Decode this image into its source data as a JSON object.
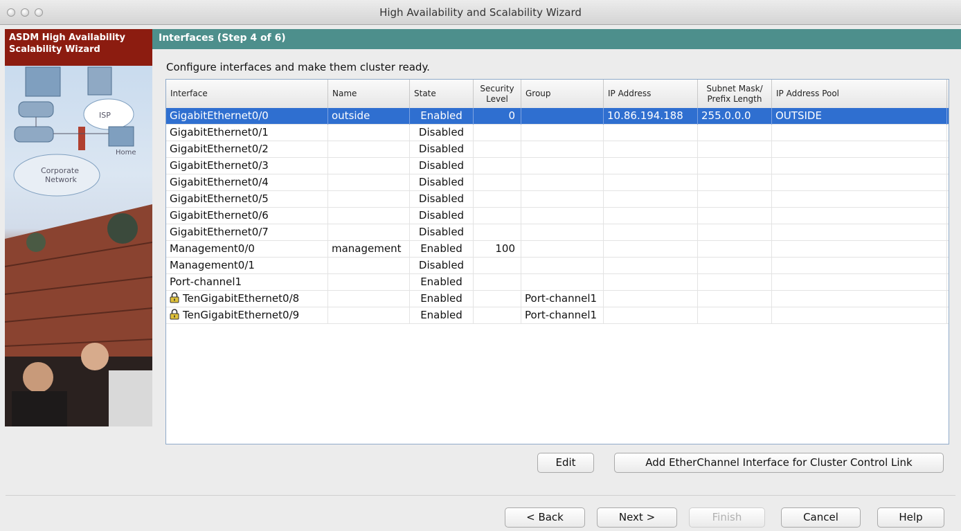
{
  "window": {
    "title": "High Availability and Scalability Wizard"
  },
  "sidebar": {
    "title_line1": "ASDM High Availability",
    "title_line2": "Scalability Wizard",
    "art_labels": {
      "isp": "ISP",
      "home": "Home",
      "corporate": "Corporate",
      "network": "Network"
    }
  },
  "header": {
    "step_title": "Interfaces (Step 4 of 6)"
  },
  "instruction": "Configure interfaces and make them cluster ready.",
  "table": {
    "columns": {
      "interface": "Interface",
      "name": "Name",
      "state": "State",
      "security_line1": "Security",
      "security_line2": "Level",
      "group": "Group",
      "ip": "IP Address",
      "mask_line1": "Subnet Mask/",
      "mask_line2": "Prefix Length",
      "pool": "IP Address Pool"
    },
    "rows": [
      {
        "interface": "GigabitEthernet0/0",
        "name": "outside",
        "state": "Enabled",
        "security": "0",
        "group": "",
        "ip": "10.86.194.188",
        "mask": "255.0.0.0",
        "pool": "OUTSIDE",
        "locked": false,
        "selected": true
      },
      {
        "interface": "GigabitEthernet0/1",
        "name": "",
        "state": "Disabled",
        "security": "",
        "group": "",
        "ip": "",
        "mask": "",
        "pool": "",
        "locked": false,
        "selected": false
      },
      {
        "interface": "GigabitEthernet0/2",
        "name": "",
        "state": "Disabled",
        "security": "",
        "group": "",
        "ip": "",
        "mask": "",
        "pool": "",
        "locked": false,
        "selected": false
      },
      {
        "interface": "GigabitEthernet0/3",
        "name": "",
        "state": "Disabled",
        "security": "",
        "group": "",
        "ip": "",
        "mask": "",
        "pool": "",
        "locked": false,
        "selected": false
      },
      {
        "interface": "GigabitEthernet0/4",
        "name": "",
        "state": "Disabled",
        "security": "",
        "group": "",
        "ip": "",
        "mask": "",
        "pool": "",
        "locked": false,
        "selected": false
      },
      {
        "interface": "GigabitEthernet0/5",
        "name": "",
        "state": "Disabled",
        "security": "",
        "group": "",
        "ip": "",
        "mask": "",
        "pool": "",
        "locked": false,
        "selected": false
      },
      {
        "interface": "GigabitEthernet0/6",
        "name": "",
        "state": "Disabled",
        "security": "",
        "group": "",
        "ip": "",
        "mask": "",
        "pool": "",
        "locked": false,
        "selected": false
      },
      {
        "interface": "GigabitEthernet0/7",
        "name": "",
        "state": "Disabled",
        "security": "",
        "group": "",
        "ip": "",
        "mask": "",
        "pool": "",
        "locked": false,
        "selected": false
      },
      {
        "interface": "Management0/0",
        "name": "management",
        "state": "Enabled",
        "security": "100",
        "group": "",
        "ip": "",
        "mask": "",
        "pool": "",
        "locked": false,
        "selected": false
      },
      {
        "interface": "Management0/1",
        "name": "",
        "state": "Disabled",
        "security": "",
        "group": "",
        "ip": "",
        "mask": "",
        "pool": "",
        "locked": false,
        "selected": false
      },
      {
        "interface": "Port-channel1",
        "name": "",
        "state": "Enabled",
        "security": "",
        "group": "",
        "ip": "",
        "mask": "",
        "pool": "",
        "locked": false,
        "selected": false
      },
      {
        "interface": "TenGigabitEthernet0/8",
        "name": "",
        "state": "Enabled",
        "security": "",
        "group": "Port-channel1",
        "ip": "",
        "mask": "",
        "pool": "",
        "locked": true,
        "selected": false
      },
      {
        "interface": "TenGigabitEthernet0/9",
        "name": "",
        "state": "Enabled",
        "security": "",
        "group": "Port-channel1",
        "ip": "",
        "mask": "",
        "pool": "",
        "locked": true,
        "selected": false
      }
    ]
  },
  "actions": {
    "edit": "Edit",
    "add_etherchannel": "Add EtherChannel Interface for Cluster Control Link"
  },
  "footer": {
    "back": "< Back",
    "next": "Next >",
    "finish": "Finish",
    "cancel": "Cancel",
    "help": "Help"
  },
  "colors": {
    "header_band": "#4d8f8c",
    "sidebar_title": "#8c1c10",
    "selection": "#2f6fd0"
  }
}
